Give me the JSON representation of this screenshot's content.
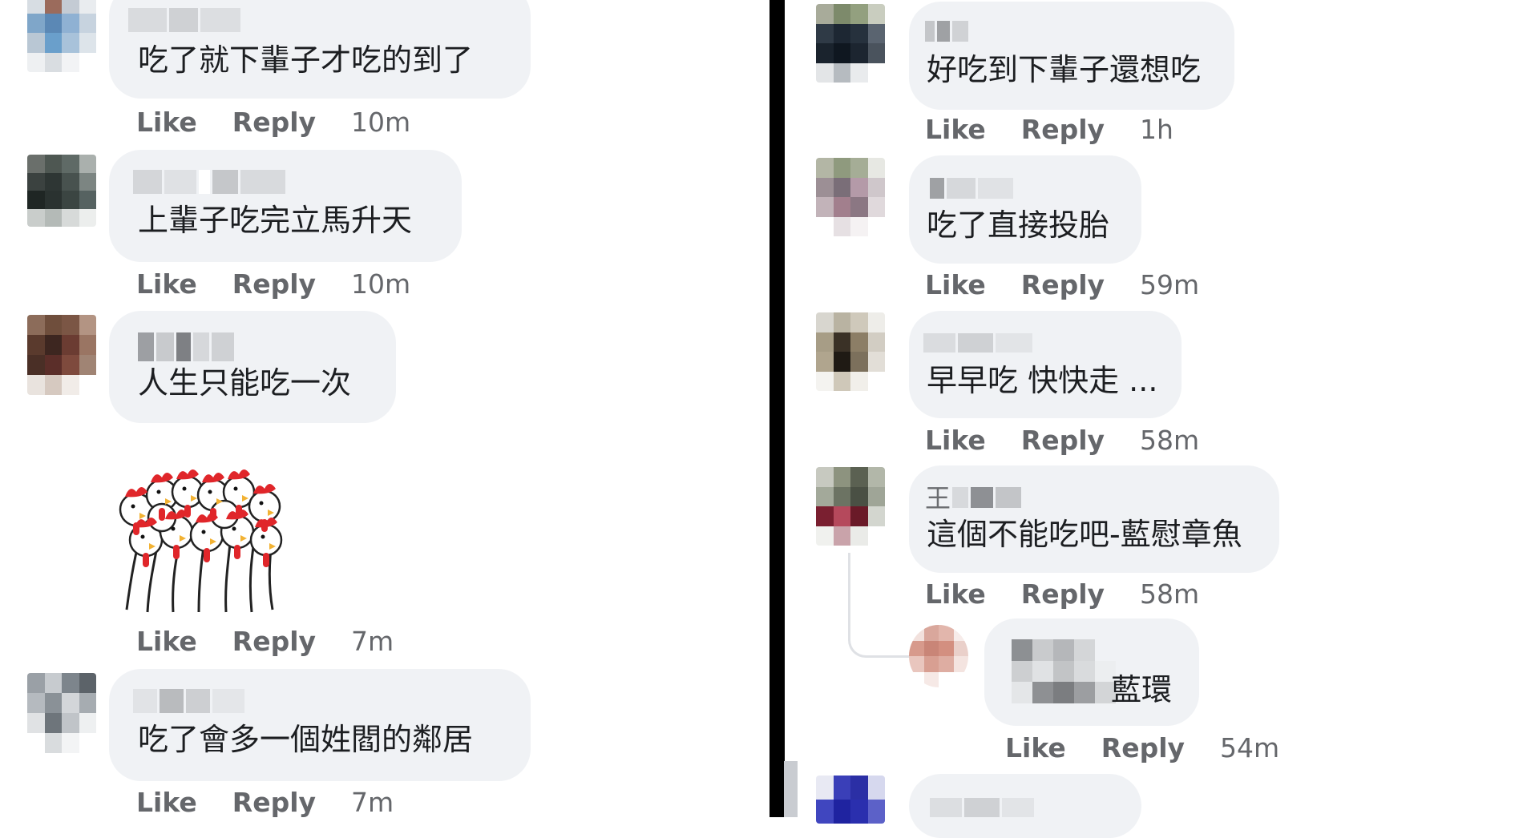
{
  "actions": {
    "like": "Like",
    "reply": "Reply"
  },
  "left_comments": [
    {
      "text": "吃了就下輩子才吃的到了",
      "time": "10m"
    },
    {
      "text": "上輩子吃完立馬升天",
      "time": "10m"
    },
    {
      "text": "人生只能吃一次",
      "time": ""
    },
    {
      "text": "",
      "time": "7m",
      "sticker": "rooster-crowd-sticker"
    },
    {
      "text": "吃了會多一個姓閻的鄰居",
      "time": "7m"
    }
  ],
  "right_comments": [
    {
      "text": "好吃到下輩子還想吃",
      "time": "1h"
    },
    {
      "text": "吃了直接投胎",
      "time": "59m"
    },
    {
      "text": "早早吃 快快走 ...",
      "time": "58m"
    },
    {
      "text": "這個不能吃吧-藍慰章魚",
      "time": "58m",
      "name_prefix": "王"
    },
    {
      "text": "藍環",
      "time": "54m",
      "is_reply": true
    }
  ],
  "colors": {
    "bubble": "#f0f2f5",
    "meta": "#65676b",
    "text": "#1c1e21",
    "divider": "#000000"
  }
}
